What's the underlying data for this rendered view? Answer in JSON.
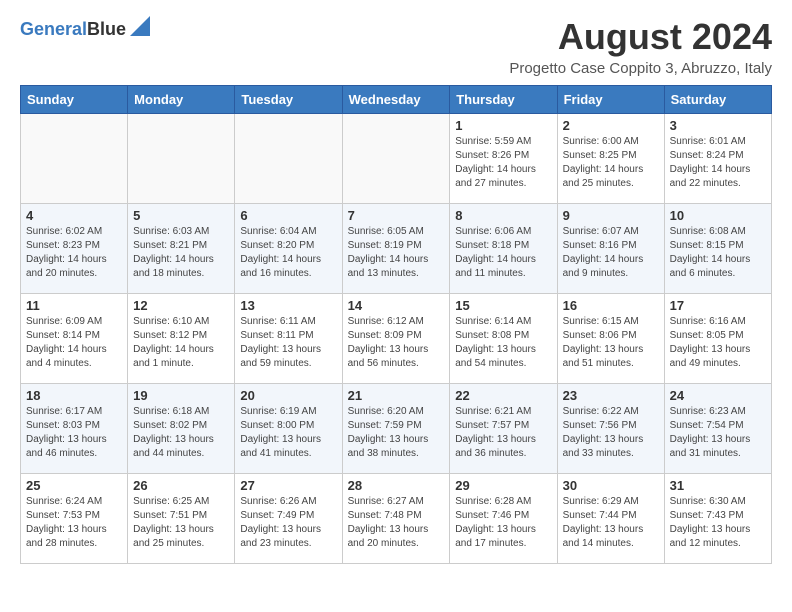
{
  "logo": {
    "line1": "General",
    "line2": "Blue"
  },
  "title": "August 2024",
  "subtitle": "Progetto Case Coppito 3, Abruzzo, Italy",
  "weekdays": [
    "Sunday",
    "Monday",
    "Tuesday",
    "Wednesday",
    "Thursday",
    "Friday",
    "Saturday"
  ],
  "weeks": [
    [
      {
        "day": "",
        "info": ""
      },
      {
        "day": "",
        "info": ""
      },
      {
        "day": "",
        "info": ""
      },
      {
        "day": "",
        "info": ""
      },
      {
        "day": "1",
        "info": "Sunrise: 5:59 AM\nSunset: 8:26 PM\nDaylight: 14 hours and 27 minutes."
      },
      {
        "day": "2",
        "info": "Sunrise: 6:00 AM\nSunset: 8:25 PM\nDaylight: 14 hours and 25 minutes."
      },
      {
        "day": "3",
        "info": "Sunrise: 6:01 AM\nSunset: 8:24 PM\nDaylight: 14 hours and 22 minutes."
      }
    ],
    [
      {
        "day": "4",
        "info": "Sunrise: 6:02 AM\nSunset: 8:23 PM\nDaylight: 14 hours and 20 minutes."
      },
      {
        "day": "5",
        "info": "Sunrise: 6:03 AM\nSunset: 8:21 PM\nDaylight: 14 hours and 18 minutes."
      },
      {
        "day": "6",
        "info": "Sunrise: 6:04 AM\nSunset: 8:20 PM\nDaylight: 14 hours and 16 minutes."
      },
      {
        "day": "7",
        "info": "Sunrise: 6:05 AM\nSunset: 8:19 PM\nDaylight: 14 hours and 13 minutes."
      },
      {
        "day": "8",
        "info": "Sunrise: 6:06 AM\nSunset: 8:18 PM\nDaylight: 14 hours and 11 minutes."
      },
      {
        "day": "9",
        "info": "Sunrise: 6:07 AM\nSunset: 8:16 PM\nDaylight: 14 hours and 9 minutes."
      },
      {
        "day": "10",
        "info": "Sunrise: 6:08 AM\nSunset: 8:15 PM\nDaylight: 14 hours and 6 minutes."
      }
    ],
    [
      {
        "day": "11",
        "info": "Sunrise: 6:09 AM\nSunset: 8:14 PM\nDaylight: 14 hours and 4 minutes."
      },
      {
        "day": "12",
        "info": "Sunrise: 6:10 AM\nSunset: 8:12 PM\nDaylight: 14 hours and 1 minute."
      },
      {
        "day": "13",
        "info": "Sunrise: 6:11 AM\nSunset: 8:11 PM\nDaylight: 13 hours and 59 minutes."
      },
      {
        "day": "14",
        "info": "Sunrise: 6:12 AM\nSunset: 8:09 PM\nDaylight: 13 hours and 56 minutes."
      },
      {
        "day": "15",
        "info": "Sunrise: 6:14 AM\nSunset: 8:08 PM\nDaylight: 13 hours and 54 minutes."
      },
      {
        "day": "16",
        "info": "Sunrise: 6:15 AM\nSunset: 8:06 PM\nDaylight: 13 hours and 51 minutes."
      },
      {
        "day": "17",
        "info": "Sunrise: 6:16 AM\nSunset: 8:05 PM\nDaylight: 13 hours and 49 minutes."
      }
    ],
    [
      {
        "day": "18",
        "info": "Sunrise: 6:17 AM\nSunset: 8:03 PM\nDaylight: 13 hours and 46 minutes."
      },
      {
        "day": "19",
        "info": "Sunrise: 6:18 AM\nSunset: 8:02 PM\nDaylight: 13 hours and 44 minutes."
      },
      {
        "day": "20",
        "info": "Sunrise: 6:19 AM\nSunset: 8:00 PM\nDaylight: 13 hours and 41 minutes."
      },
      {
        "day": "21",
        "info": "Sunrise: 6:20 AM\nSunset: 7:59 PM\nDaylight: 13 hours and 38 minutes."
      },
      {
        "day": "22",
        "info": "Sunrise: 6:21 AM\nSunset: 7:57 PM\nDaylight: 13 hours and 36 minutes."
      },
      {
        "day": "23",
        "info": "Sunrise: 6:22 AM\nSunset: 7:56 PM\nDaylight: 13 hours and 33 minutes."
      },
      {
        "day": "24",
        "info": "Sunrise: 6:23 AM\nSunset: 7:54 PM\nDaylight: 13 hours and 31 minutes."
      }
    ],
    [
      {
        "day": "25",
        "info": "Sunrise: 6:24 AM\nSunset: 7:53 PM\nDaylight: 13 hours and 28 minutes."
      },
      {
        "day": "26",
        "info": "Sunrise: 6:25 AM\nSunset: 7:51 PM\nDaylight: 13 hours and 25 minutes."
      },
      {
        "day": "27",
        "info": "Sunrise: 6:26 AM\nSunset: 7:49 PM\nDaylight: 13 hours and 23 minutes."
      },
      {
        "day": "28",
        "info": "Sunrise: 6:27 AM\nSunset: 7:48 PM\nDaylight: 13 hours and 20 minutes."
      },
      {
        "day": "29",
        "info": "Sunrise: 6:28 AM\nSunset: 7:46 PM\nDaylight: 13 hours and 17 minutes."
      },
      {
        "day": "30",
        "info": "Sunrise: 6:29 AM\nSunset: 7:44 PM\nDaylight: 13 hours and 14 minutes."
      },
      {
        "day": "31",
        "info": "Sunrise: 6:30 AM\nSunset: 7:43 PM\nDaylight: 13 hours and 12 minutes."
      }
    ]
  ]
}
